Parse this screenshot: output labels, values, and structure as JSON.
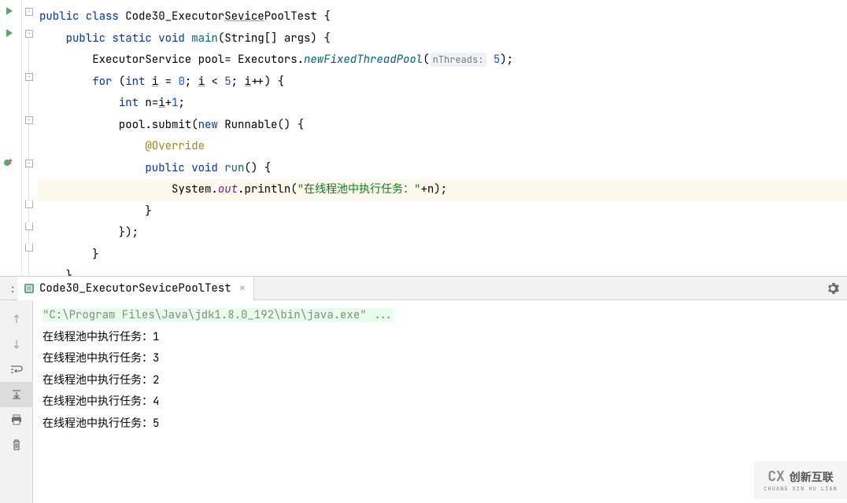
{
  "code": {
    "lines": [
      {
        "indent": 0,
        "tokens": [
          {
            "cls": "kw",
            "t": "public class"
          },
          {
            "cls": "",
            "t": " Code30_Executor"
          },
          {
            "cls": "underline",
            "t": "Sevice"
          },
          {
            "cls": "",
            "t": "PoolTest {"
          }
        ]
      },
      {
        "indent": 1,
        "tokens": [
          {
            "cls": "kw",
            "t": "public static void"
          },
          {
            "cls": "",
            "t": " "
          },
          {
            "cls": "method",
            "t": "main"
          },
          {
            "cls": "",
            "t": "(String[] args) {"
          }
        ]
      },
      {
        "indent": 2,
        "tokens": [
          {
            "cls": "",
            "t": "ExecutorService pool= Executors."
          },
          {
            "cls": "method-italic",
            "t": "newFixedThreadPool"
          },
          {
            "cls": "",
            "t": "("
          },
          {
            "cls": "param-hint",
            "t": "nThreads:"
          },
          {
            "cls": "",
            "t": " "
          },
          {
            "cls": "num",
            "t": "5"
          },
          {
            "cls": "",
            "t": ");"
          }
        ]
      },
      {
        "indent": 2,
        "tokens": [
          {
            "cls": "kw",
            "t": "for"
          },
          {
            "cls": "",
            "t": " ("
          },
          {
            "cls": "kw",
            "t": "int"
          },
          {
            "cls": "",
            "t": " "
          },
          {
            "cls": "underline",
            "t": "i"
          },
          {
            "cls": "",
            "t": " = "
          },
          {
            "cls": "num",
            "t": "0"
          },
          {
            "cls": "",
            "t": "; "
          },
          {
            "cls": "underline",
            "t": "i"
          },
          {
            "cls": "",
            "t": " < "
          },
          {
            "cls": "num",
            "t": "5"
          },
          {
            "cls": "",
            "t": "; "
          },
          {
            "cls": "underline",
            "t": "i"
          },
          {
            "cls": "",
            "t": "++) {"
          }
        ]
      },
      {
        "indent": 3,
        "tokens": [
          {
            "cls": "kw",
            "t": "int"
          },
          {
            "cls": "",
            "t": " n="
          },
          {
            "cls": "underline",
            "t": "i"
          },
          {
            "cls": "",
            "t": "+"
          },
          {
            "cls": "num",
            "t": "1"
          },
          {
            "cls": "",
            "t": ";"
          }
        ]
      },
      {
        "indent": 3,
        "tokens": [
          {
            "cls": "",
            "t": "pool.submit("
          },
          {
            "cls": "kw",
            "t": "new"
          },
          {
            "cls": "",
            "t": " Runnable() {"
          }
        ]
      },
      {
        "indent": 4,
        "tokens": [
          {
            "cls": "anno",
            "t": "@Override"
          }
        ]
      },
      {
        "indent": 4,
        "tokens": [
          {
            "cls": "kw",
            "t": "public void"
          },
          {
            "cls": "",
            "t": " "
          },
          {
            "cls": "method",
            "t": "run"
          },
          {
            "cls": "",
            "t": "() {"
          }
        ]
      },
      {
        "indent": 5,
        "highlight": true,
        "tokens": [
          {
            "cls": "",
            "t": "System."
          },
          {
            "cls": "field-italic",
            "t": "out"
          },
          {
            "cls": "",
            "t": ".println("
          },
          {
            "cls": "str",
            "t": "\"在线程池中执行任务：\""
          },
          {
            "cls": "",
            "t": "+n);"
          }
        ]
      },
      {
        "indent": 4,
        "tokens": [
          {
            "cls": "",
            "t": "}"
          }
        ]
      },
      {
        "indent": 3,
        "tokens": [
          {
            "cls": "",
            "t": "});"
          }
        ]
      },
      {
        "indent": 2,
        "tokens": [
          {
            "cls": "",
            "t": "}"
          }
        ]
      },
      {
        "indent": 1,
        "partial": true,
        "tokens": [
          {
            "cls": "",
            "t": "}"
          }
        ]
      }
    ]
  },
  "tab": {
    "name": "Code30_ExecutorSevicePoolTest"
  },
  "runLabelSuffix": ":",
  "console": {
    "command": "\"C:\\Program Files\\Java\\jdk1.8.0_192\\bin\\java.exe\" ...",
    "outputs": [
      "在线程池中执行任务：1",
      "在线程池中执行任务：3",
      "在线程池中执行任务：2",
      "在线程池中执行任务：4",
      "在线程池中执行任务：5"
    ]
  },
  "watermark": {
    "logo": "CX",
    "main": "创新互联",
    "sub": "CHUANG XIN HU LIAN"
  }
}
